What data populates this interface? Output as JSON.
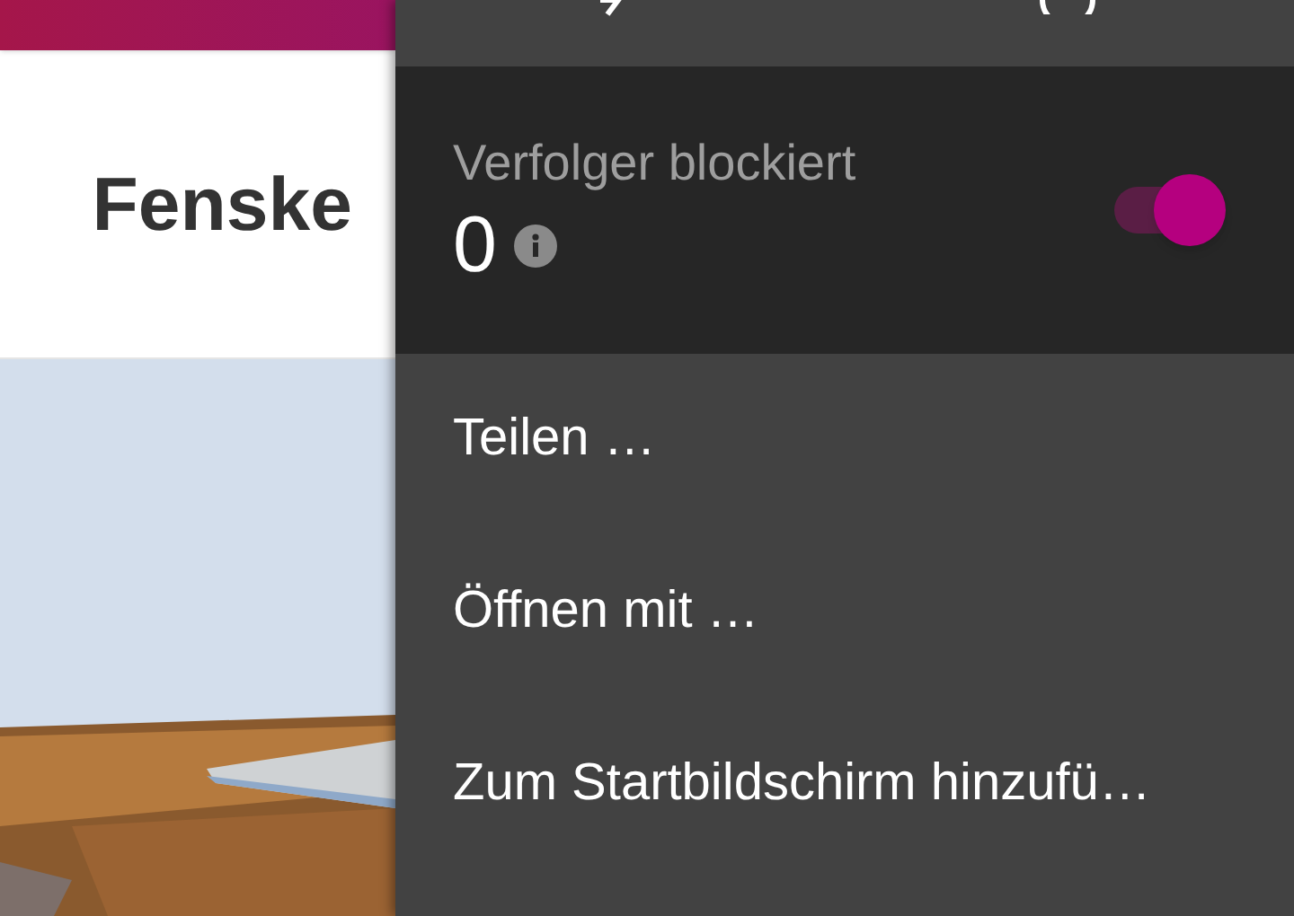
{
  "page": {
    "heading": "Fenske"
  },
  "menu": {
    "tracker": {
      "label": "Verfolger blockiert",
      "count": "0",
      "on": true
    },
    "items": [
      {
        "label": "Teilen …"
      },
      {
        "label": "Öffnen mit …"
      },
      {
        "label": "Zum Startbildschirm hinzufü…"
      }
    ]
  }
}
